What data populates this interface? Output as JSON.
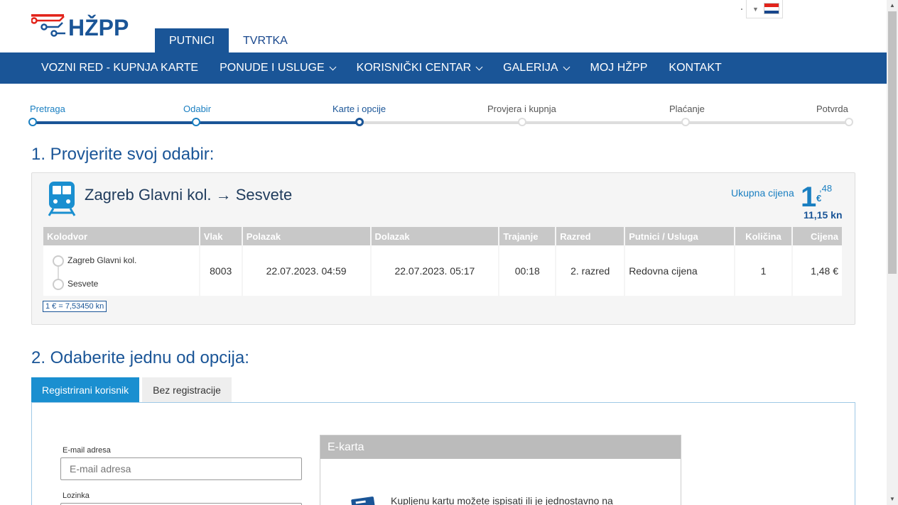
{
  "brand": {
    "logo_text": "HŽPP",
    "colors": {
      "primary": "#1a5597",
      "accent": "#1a8fd0",
      "logo_red": "#e2231a",
      "logo_blue": "#1a5597"
    }
  },
  "language": {
    "flag_icon": "croatian-flag-icon"
  },
  "top_tabs": [
    {
      "label": "PUTNICI",
      "active": true
    },
    {
      "label": "TVRTKA",
      "active": false
    }
  ],
  "nav": [
    {
      "label": "VOZNI RED - KUPNJA KARTE",
      "dropdown": false
    },
    {
      "label": "PONUDE I USLUGE",
      "dropdown": true
    },
    {
      "label": "KORISNIČKI CENTAR",
      "dropdown": true
    },
    {
      "label": "GALERIJA",
      "dropdown": true
    },
    {
      "label": "MOJ HŽPP",
      "dropdown": false
    },
    {
      "label": "KONTAKT",
      "dropdown": false
    }
  ],
  "steps": [
    {
      "label": "Pretraga",
      "state": "done"
    },
    {
      "label": "Odabir",
      "state": "done"
    },
    {
      "label": "Karte i opcije",
      "state": "current"
    },
    {
      "label": "Provjera i kupnja",
      "state": "todo"
    },
    {
      "label": "Plaćanje",
      "state": "todo"
    },
    {
      "label": "Potvrda",
      "state": "todo"
    }
  ],
  "section1": {
    "title": "1. Provjerite svoj odabir:",
    "route": "Zagreb Glavni kol. → Sesvete",
    "total_label": "Ukupna cijena",
    "price_whole": "1",
    "price_cents": ",48",
    "price_currency": "€",
    "price_kn": "11,15 kn",
    "table": {
      "headers": [
        "Kolodvor",
        "Vlak",
        "Polazak",
        "Dolazak",
        "Trajanje",
        "Razred",
        "Putnici / Usluga",
        "Količina",
        "Cijena"
      ],
      "row": {
        "from_station": "Zagreb Glavni kol.",
        "to_station": "Sesvete",
        "train": "8003",
        "departure": "22.07.2023. 04:59",
        "arrival": "22.07.2023. 05:17",
        "duration": "00:18",
        "class": "2. razred",
        "fare": "Redovna cijena",
        "quantity": "1",
        "price": "1,48 €"
      }
    },
    "exchange_rate": "1 € = 7,53450 kn"
  },
  "section2": {
    "title": "2. Odaberite jednu od opcija:",
    "tabs": [
      {
        "label": "Registrirani korisnik",
        "active": true
      },
      {
        "label": "Bez registracije",
        "active": false
      }
    ],
    "email_label": "E-mail adresa",
    "email_placeholder": "E-mail adresa",
    "password_label": "Lozinka",
    "ekarta_title": "E-karta",
    "ekarta_text": "Kupljenu kartu možete ispisati ili je jednostavno na"
  }
}
